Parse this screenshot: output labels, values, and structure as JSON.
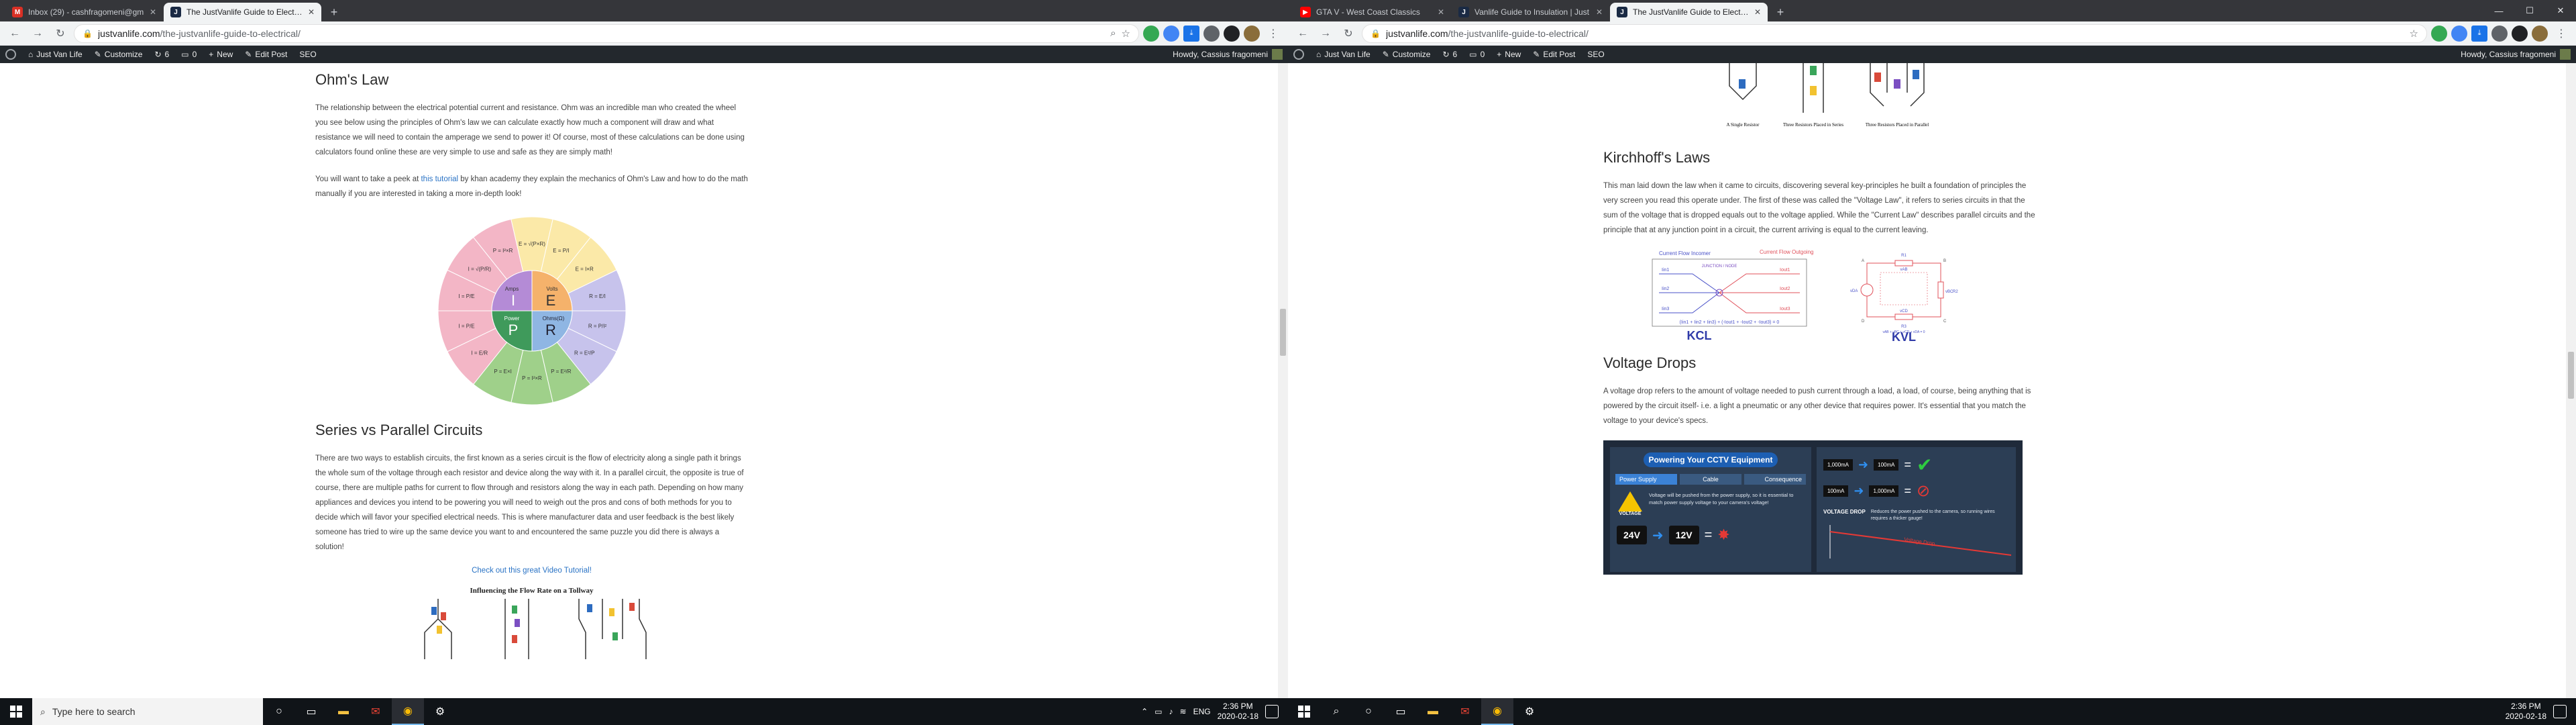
{
  "left": {
    "tabs": [
      {
        "favicon": "M",
        "title": "Inbox (29) - cashfragomeni@gm",
        "active": false
      },
      {
        "favicon": "J",
        "title": "The JustVanlife Guide to Electric",
        "active": true
      }
    ],
    "url_domain": "justvanlife.com",
    "url_path": "/the-justvanlife-guide-to-electrical/",
    "wpbar": {
      "site": "Just Van Life",
      "customize": "Customize",
      "updates": "6",
      "comments": "0",
      "new": "New",
      "edit": "Edit Post",
      "seo": "SEO",
      "howdy": "Howdy, Cassius fragomeni"
    },
    "ohms": {
      "heading": "Ohm's Law",
      "p1": "The relationship between the electrical potential current and resistance. Ohm was an incredible man who created the wheel you see below using the principles of Ohm's law we can calculate exactly how much a component will draw and what resistance we will need to contain the amperage we send to power it! Of course, most of these calculations can be done using calculators found online these are very simple to use and safe as they are simply math!",
      "p2_pre": "You will want to take a peek at ",
      "p2_link": "this tutorial",
      "p2_post": " by khan academy they explain the mechanics of Ohm's Law and how to do the math manually if you are interested in taking a more in-depth look!"
    },
    "wheel": {
      "center": {
        "amps_label": "Amps",
        "amps": "I",
        "volts_label": "Volts",
        "volts": "E",
        "power_label": "Power",
        "power": "P",
        "ohms_label": "Ohms(Ω)",
        "ohms": "R"
      },
      "outer": [
        "I = P/E",
        "I = √(P/R)",
        "P = I²×R",
        "E = √(P×R)",
        "E = P/I",
        "E = I×R",
        "R = E/I",
        "R = P/I²",
        "R = E²/P",
        "P = E²/R",
        "P = I²×R",
        "P = E×I",
        "I = E/R",
        "I = P/E"
      ]
    },
    "series": {
      "heading": "Series vs Parallel Circuits",
      "p1": "There are two ways to establish circuits, the first known as a series circuit is the flow of electricity along a single path it brings the whole sum of the voltage through each resistor and device along the way with it. In a parallel circuit, the opposite is true of course, there are multiple paths for current to flow through and resistors along the way in each path. Depending on how many appliances and devices you intend to be powering you will need to weigh out the pros and cons of both methods for you to decide which will favor your specified electrical needs. This is where manufacturer data and user feedback is the best likely someone has tried to wire up the same device you want to and encountered the same puzzle you did there is always a solution!",
      "link": "Check out this great Video Tutorial!",
      "figure_title": "Influencing the Flow Rate on a Tollway"
    },
    "taskbar": {
      "search": "Type here to search",
      "lang": "ENG",
      "time": "2:36 PM",
      "date": "2020-02-18"
    }
  },
  "right": {
    "tabs": [
      {
        "favicon": "▶",
        "title": "GTA V - West Coast Classics",
        "active": false
      },
      {
        "favicon": "J",
        "title": "Vanlife Guide to Insulation | Just",
        "active": false
      },
      {
        "favicon": "J",
        "title": "The JustVanlife Guide to Electric",
        "active": true
      }
    ],
    "url_domain": "justvanlife.com",
    "url_path": "/the-justvanlife-guide-to-electrical/",
    "figure_top_labels": [
      "A Single Resistor",
      "Three Resistors Placed in Series",
      "Three Resistors Placed in Parallel"
    ],
    "kirchhoff": {
      "heading": "Kirchhoff's Laws",
      "p1": "This man laid down the law when it came to circuits, discovering several key-principles he built a foundation of principles the very screen you read this operate under. The first of these was called the \"Voltage Law\", it refers to series circuits in that the sum of the voltage that is dropped equals out to the voltage applied. While the \"Current Law\" describes parallel circuits and the principle that at any junction point in a circuit, the current arriving is equal to the current leaving."
    },
    "kcl": {
      "incoming": "Current Flow Incomer",
      "outgoing": "Current Flow Outgoing",
      "junction": "JUNCTION / NODE",
      "in_labels": [
        "Iin1",
        "Iin2",
        "Iin3"
      ],
      "out_labels": [
        "Iout1",
        "Iout2",
        "Iout3"
      ],
      "equation": "(Iin1 + Iin2 + Iin3) + (-Iout1 + -Iout2 + -Iout3) = 0",
      "label": "KCL"
    },
    "kvl": {
      "corners": [
        "A",
        "B",
        "C",
        "D"
      ],
      "r_labels": [
        "R1",
        "R2",
        "R3"
      ],
      "v_labels": [
        "vAB",
        "vBC",
        "vCD",
        "vDA"
      ],
      "equation": "vAB + vBC + vCD + vDA = 0",
      "label": "KVL"
    },
    "voltage": {
      "heading": "Voltage Drops",
      "p1": "A voltage drop refers to the amount of voltage needed to push current through a load, a load, of course, being anything that is powered by the circuit itself- i.e. a light a pneumatic or any other device that requires power. It's essential that you match the voltage to your device's specs."
    },
    "cctv": {
      "title": "Powering Your CCTV Equipment",
      "tabs": [
        "Power Supply",
        "Cable",
        "Consequence"
      ],
      "voltage_label": "VOLTAGE",
      "warn": "Voltage will be pushed from the power supply, so it is essential to match power supply voltage to your camera's voltage!",
      "v1": "24V",
      "v2": "12V",
      "amp1": "1,000mA",
      "amp2": "100mA",
      "amp3": "100mA",
      "amp4": "1,000mA",
      "drop_title": "VOLTAGE DROP",
      "drop_text": "Reduces the power pushed to the camera, so running wires requires a thicker gauge!",
      "drop_label": "Voltage Drop"
    },
    "taskbar": {
      "time": "2:36 PM",
      "date": "2020-02-18"
    }
  },
  "colors": {
    "tabstrip": "#35363a",
    "wpbar": "#23282d",
    "link": "#2a73c5",
    "taskbar": "#101418",
    "kcl_blue": "#4a52c8",
    "kcl_red": "#e0505a"
  }
}
